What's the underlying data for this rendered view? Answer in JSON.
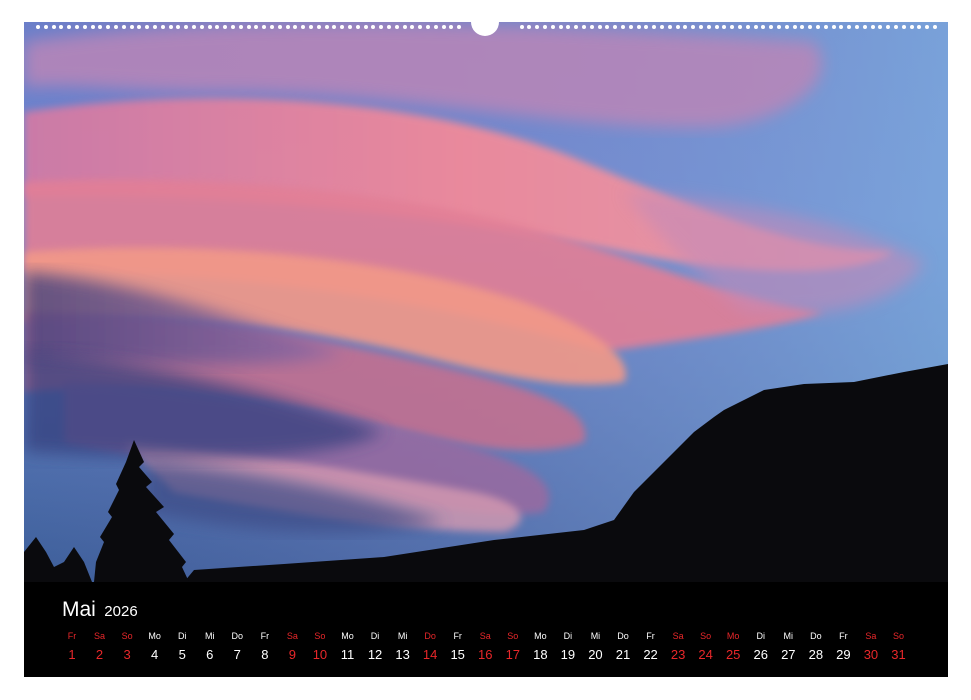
{
  "calendar": {
    "month": "Mai",
    "year": "2026",
    "accent_color": "#e8272a",
    "days": [
      {
        "wd": "Fr",
        "n": "1",
        "red": true
      },
      {
        "wd": "Sa",
        "n": "2",
        "red": true
      },
      {
        "wd": "So",
        "n": "3",
        "red": true
      },
      {
        "wd": "Mo",
        "n": "4",
        "red": false
      },
      {
        "wd": "Di",
        "n": "5",
        "red": false
      },
      {
        "wd": "Mi",
        "n": "6",
        "red": false
      },
      {
        "wd": "Do",
        "n": "7",
        "red": false
      },
      {
        "wd": "Fr",
        "n": "8",
        "red": false
      },
      {
        "wd": "Sa",
        "n": "9",
        "red": true
      },
      {
        "wd": "So",
        "n": "10",
        "red": true
      },
      {
        "wd": "Mo",
        "n": "11",
        "red": false
      },
      {
        "wd": "Di",
        "n": "12",
        "red": false
      },
      {
        "wd": "Mi",
        "n": "13",
        "red": false
      },
      {
        "wd": "Do",
        "n": "14",
        "red": true
      },
      {
        "wd": "Fr",
        "n": "15",
        "red": false
      },
      {
        "wd": "Sa",
        "n": "16",
        "red": true
      },
      {
        "wd": "So",
        "n": "17",
        "red": true
      },
      {
        "wd": "Mo",
        "n": "18",
        "red": false
      },
      {
        "wd": "Di",
        "n": "19",
        "red": false
      },
      {
        "wd": "Mi",
        "n": "20",
        "red": false
      },
      {
        "wd": "Do",
        "n": "21",
        "red": false
      },
      {
        "wd": "Fr",
        "n": "22",
        "red": false
      },
      {
        "wd": "Sa",
        "n": "23",
        "red": true
      },
      {
        "wd": "So",
        "n": "24",
        "red": true
      },
      {
        "wd": "Mo",
        "n": "25",
        "red": true
      },
      {
        "wd": "Di",
        "n": "26",
        "red": false
      },
      {
        "wd": "Mi",
        "n": "27",
        "red": false
      },
      {
        "wd": "Do",
        "n": "28",
        "red": false
      },
      {
        "wd": "Fr",
        "n": "29",
        "red": false
      },
      {
        "wd": "Sa",
        "n": "30",
        "red": true
      },
      {
        "wd": "So",
        "n": "31",
        "red": true
      }
    ]
  }
}
